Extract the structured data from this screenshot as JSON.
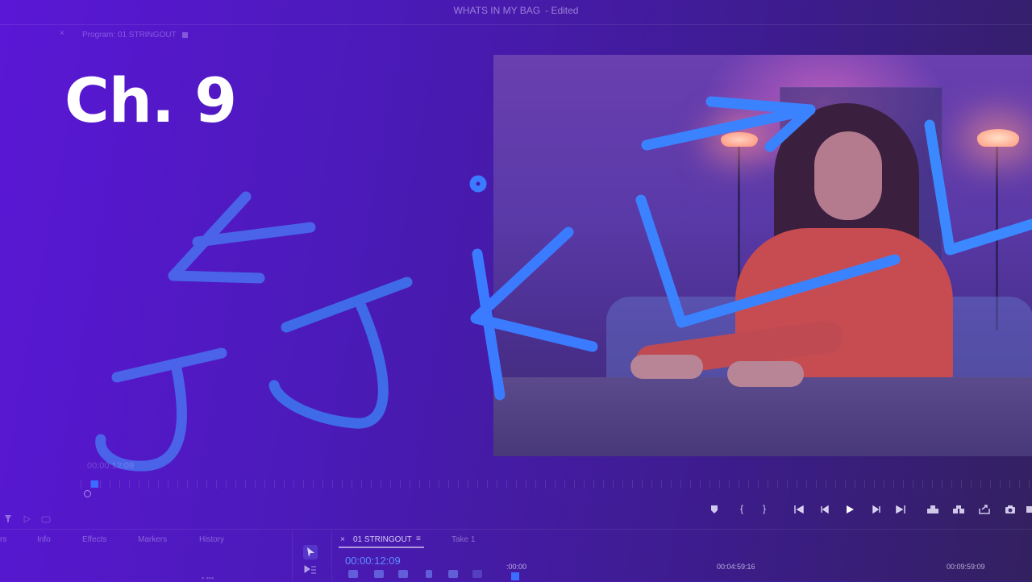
{
  "window": {
    "title": "WHATS IN MY BAG",
    "status": "- Edited"
  },
  "monitor": {
    "tab_close": "×",
    "tab_label": "Program: 01 STRINGOUT",
    "faint_timecode": "00:00:12:09"
  },
  "overlay": {
    "chapter": "Ch. 9",
    "drawn_letters": [
      "J",
      "J",
      "K",
      "L",
      "L"
    ],
    "stroke_color": "#3b7bff"
  },
  "transport": {
    "buttons": [
      "add-marker",
      "mark-in",
      "mark-out",
      "go-to-in",
      "step-back",
      "play",
      "step-forward",
      "go-to-out",
      "lift",
      "extract",
      "export-frame-share",
      "export-frame"
    ]
  },
  "panels": {
    "tabs": [
      "rs",
      "Info",
      "Effects",
      "Markers",
      "History"
    ]
  },
  "timeline": {
    "close": "×",
    "sequence_name": "01 STRINGOUT",
    "menu": "≡",
    "take_label": "Take 1",
    "timecode": "00:00:12:09",
    "ruler_ticks": [
      ":00:00",
      "00:04:59:16",
      "00:09:59:09"
    ]
  },
  "colors": {
    "accent": "#5f8dff",
    "playhead": "#3b6cff"
  }
}
